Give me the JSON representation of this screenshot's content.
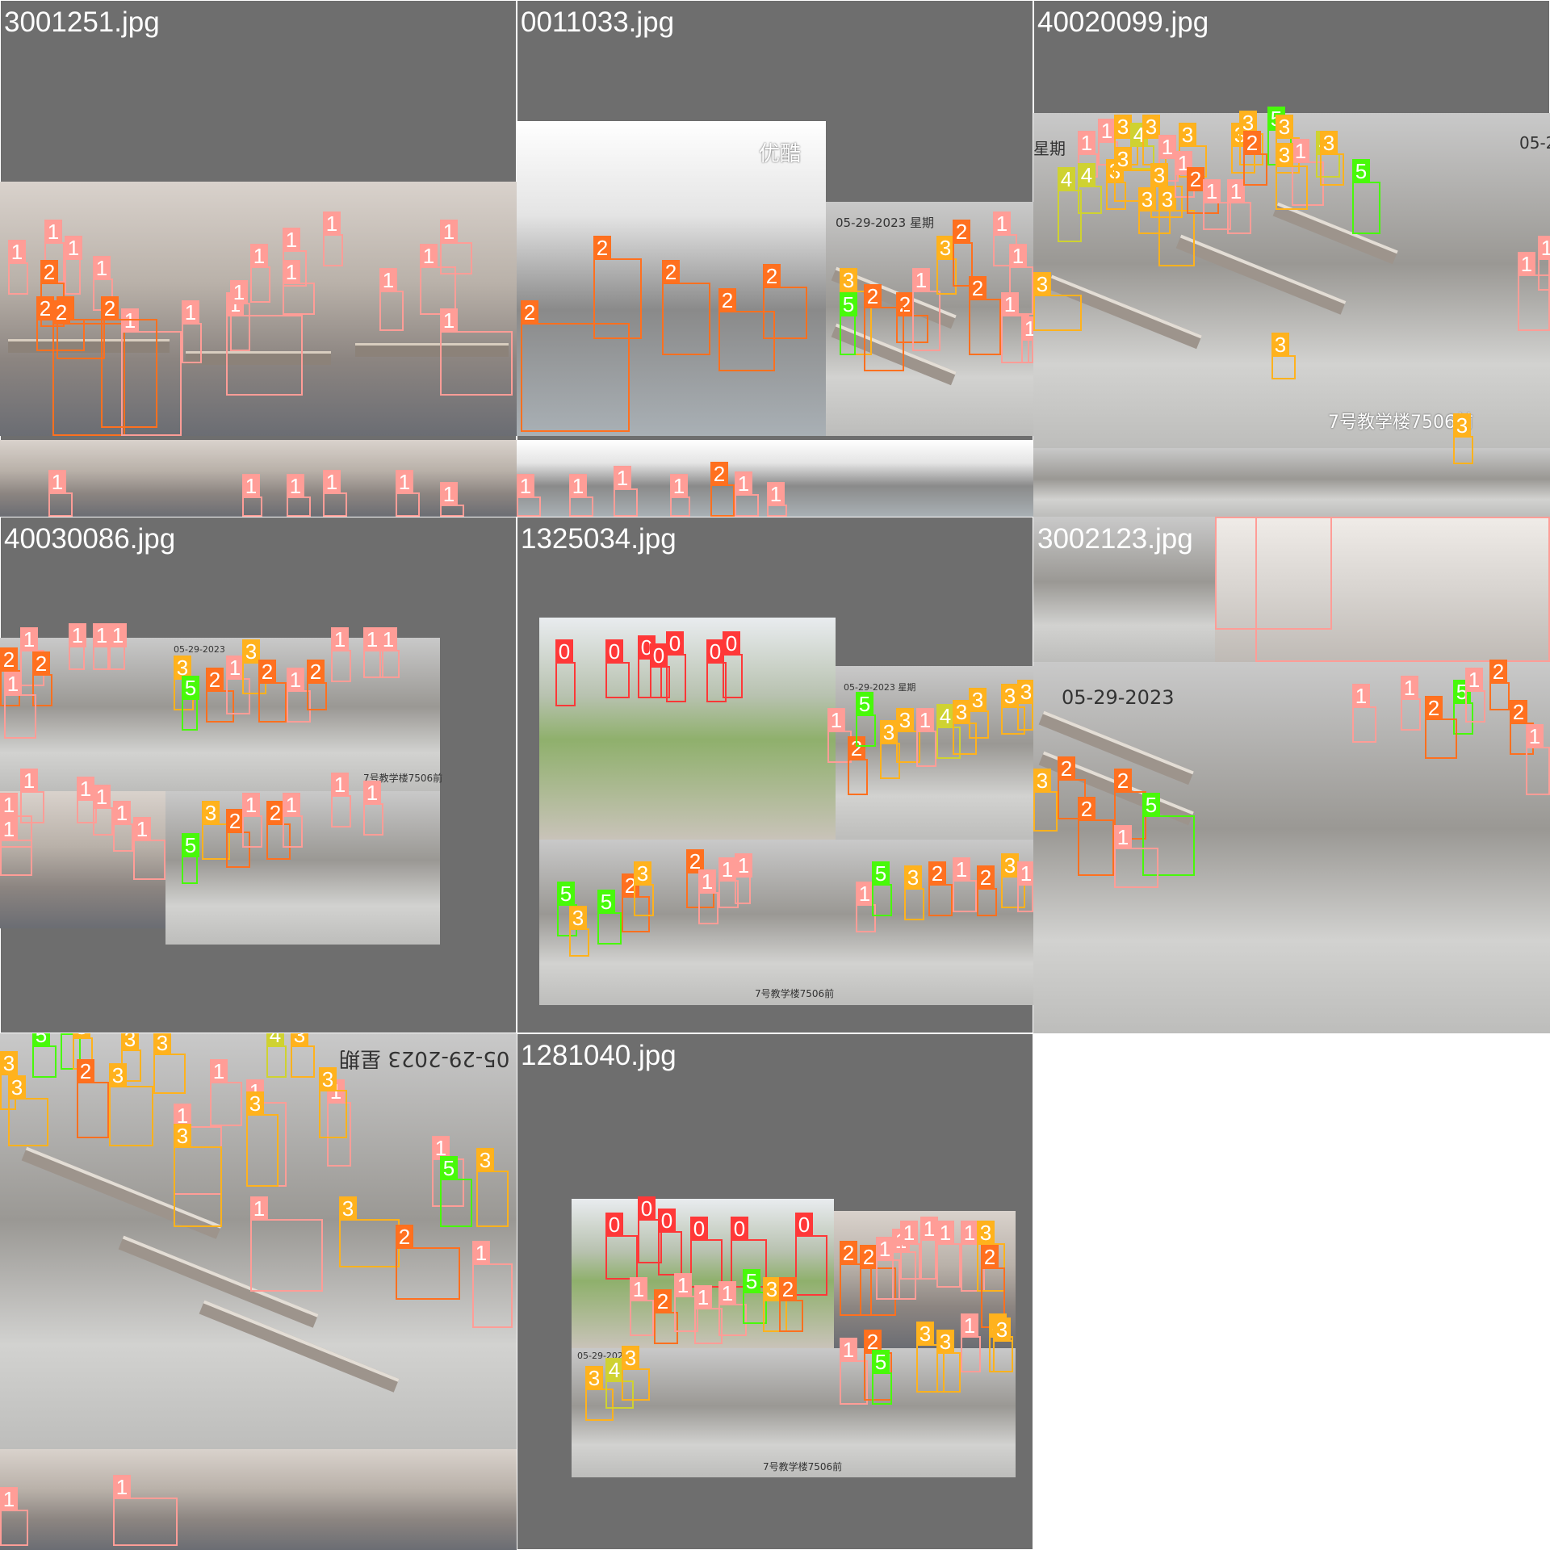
{
  "class_colors": {
    "0": "#ff3838",
    "1": "#ff9d97",
    "2": "#ff701f",
    "3": "#ffb21d",
    "4": "#cfd231",
    "5": "#48f90a"
  },
  "tiles": [
    {
      "label": "3001251.jpg",
      "boxes": [
        {
          "cls": "1"
        },
        {
          "cls": "1"
        },
        {
          "cls": "1"
        },
        {
          "cls": "2"
        },
        {
          "cls": "1"
        },
        {
          "cls": "2"
        },
        {
          "cls": "2"
        },
        {
          "cls": "2"
        },
        {
          "cls": "1"
        },
        {
          "cls": "2"
        },
        {
          "cls": "1"
        },
        {
          "cls": "1"
        },
        {
          "cls": "1"
        },
        {
          "cls": "1"
        },
        {
          "cls": "1"
        },
        {
          "cls": "1"
        },
        {
          "cls": "1"
        },
        {
          "cls": "1"
        },
        {
          "cls": "1"
        },
        {
          "cls": "1"
        },
        {
          "cls": "1"
        },
        {
          "cls": "1"
        },
        {
          "cls": "1"
        },
        {
          "cls": "1"
        },
        {
          "cls": "1"
        },
        {
          "cls": "1"
        },
        {
          "cls": "1"
        }
      ]
    },
    {
      "label": "0011033.jpg",
      "overlays": [
        "优酷",
        "05-29-2023 星期"
      ],
      "boxes": [
        {
          "cls": "2"
        },
        {
          "cls": "2"
        },
        {
          "cls": "2"
        },
        {
          "cls": "2"
        },
        {
          "cls": "2"
        },
        {
          "cls": "3"
        },
        {
          "cls": "2"
        },
        {
          "cls": "1"
        },
        {
          "cls": "5"
        },
        {
          "cls": "2"
        },
        {
          "cls": "3"
        },
        {
          "cls": "2"
        },
        {
          "cls": "1"
        },
        {
          "cls": "2"
        },
        {
          "cls": "1"
        },
        {
          "cls": "1"
        },
        {
          "cls": "1"
        },
        {
          "cls": "1"
        },
        {
          "cls": "1"
        },
        {
          "cls": "1"
        },
        {
          "cls": "1"
        },
        {
          "cls": "2"
        },
        {
          "cls": "1"
        },
        {
          "cls": "1"
        },
        {
          "cls": "1"
        }
      ]
    },
    {
      "label": "40020099.jpg",
      "overlays": [
        "7号教学楼7506前",
        "05-2",
        "星期"
      ],
      "boxes": [
        {
          "cls": "1"
        },
        {
          "cls": "1"
        },
        {
          "cls": "3"
        },
        {
          "cls": "4"
        },
        {
          "cls": "3"
        },
        {
          "cls": "1"
        },
        {
          "cls": "3"
        },
        {
          "cls": "3"
        },
        {
          "cls": "3"
        },
        {
          "cls": "5"
        },
        {
          "cls": "3"
        },
        {
          "cls": "1"
        },
        {
          "cls": "4"
        },
        {
          "cls": "4"
        },
        {
          "cls": "4"
        },
        {
          "cls": "3"
        },
        {
          "cls": "3"
        },
        {
          "cls": "3"
        },
        {
          "cls": "3"
        },
        {
          "cls": "1"
        },
        {
          "cls": "2"
        },
        {
          "cls": "1"
        },
        {
          "cls": "1"
        },
        {
          "cls": "3"
        },
        {
          "cls": "2"
        },
        {
          "cls": "3"
        },
        {
          "cls": "3"
        },
        {
          "cls": "5"
        },
        {
          "cls": "3"
        },
        {
          "cls": "3"
        },
        {
          "cls": "1"
        },
        {
          "cls": "1"
        },
        {
          "cls": "3"
        }
      ]
    },
    {
      "label": "40030086.jpg",
      "overlays": [
        "7号教学楼7506前",
        "05-29-2023"
      ],
      "boxes": [
        {
          "cls": "2"
        },
        {
          "cls": "1"
        },
        {
          "cls": "2"
        },
        {
          "cls": "1"
        },
        {
          "cls": "1"
        },
        {
          "cls": "1"
        },
        {
          "cls": "1"
        },
        {
          "cls": "3"
        },
        {
          "cls": "5"
        },
        {
          "cls": "2"
        },
        {
          "cls": "1"
        },
        {
          "cls": "3"
        },
        {
          "cls": "2"
        },
        {
          "cls": "1"
        },
        {
          "cls": "2"
        },
        {
          "cls": "1"
        },
        {
          "cls": "1"
        },
        {
          "cls": "1"
        },
        {
          "cls": "1"
        },
        {
          "cls": "1"
        },
        {
          "cls": "1"
        },
        {
          "cls": "1"
        },
        {
          "cls": "1"
        },
        {
          "cls": "1"
        },
        {
          "cls": "1"
        },
        {
          "cls": "5"
        },
        {
          "cls": "3"
        },
        {
          "cls": "2"
        },
        {
          "cls": "1"
        },
        {
          "cls": "2"
        },
        {
          "cls": "1"
        },
        {
          "cls": "1"
        },
        {
          "cls": "1"
        }
      ]
    },
    {
      "label": "1325034.jpg",
      "overlays": [
        "7号教学楼7506前",
        "05-29-2023 星期"
      ],
      "boxes": [
        {
          "cls": "0"
        },
        {
          "cls": "0"
        },
        {
          "cls": "0"
        },
        {
          "cls": "0"
        },
        {
          "cls": "0"
        },
        {
          "cls": "0"
        },
        {
          "cls": "0"
        },
        {
          "cls": "1"
        },
        {
          "cls": "2"
        },
        {
          "cls": "5"
        },
        {
          "cls": "3"
        },
        {
          "cls": "3"
        },
        {
          "cls": "1"
        },
        {
          "cls": "4"
        },
        {
          "cls": "3"
        },
        {
          "cls": "3"
        },
        {
          "cls": "3"
        },
        {
          "cls": "3"
        },
        {
          "cls": "5"
        },
        {
          "cls": "3"
        },
        {
          "cls": "5"
        },
        {
          "cls": "2"
        },
        {
          "cls": "3"
        },
        {
          "cls": "2"
        },
        {
          "cls": "1"
        },
        {
          "cls": "1"
        },
        {
          "cls": "1"
        },
        {
          "cls": "1"
        },
        {
          "cls": "5"
        },
        {
          "cls": "3"
        },
        {
          "cls": "2"
        },
        {
          "cls": "1"
        },
        {
          "cls": "2"
        },
        {
          "cls": "3"
        },
        {
          "cls": "1"
        }
      ]
    },
    {
      "label": "3002123.jpg",
      "overlays": [
        "05-29-2023"
      ],
      "boxes": [
        {
          "cls": "1"
        },
        {
          "cls": "1"
        },
        {
          "cls": "1"
        },
        {
          "cls": "1"
        },
        {
          "cls": "5"
        },
        {
          "cls": "1"
        },
        {
          "cls": "2"
        },
        {
          "cls": "2"
        },
        {
          "cls": "2"
        },
        {
          "cls": "1"
        },
        {
          "cls": "3"
        },
        {
          "cls": "2"
        },
        {
          "cls": "2"
        },
        {
          "cls": "5"
        },
        {
          "cls": "2"
        },
        {
          "cls": "1"
        }
      ]
    },
    {
      "label": "",
      "overlays": [
        "05-29-2023 星期"
      ],
      "boxes": [
        {
          "cls": "3"
        },
        {
          "cls": "5"
        },
        {
          "cls": "5"
        },
        {
          "cls": "3"
        },
        {
          "cls": "3"
        },
        {
          "cls": "3"
        },
        {
          "cls": "3"
        },
        {
          "cls": "2"
        },
        {
          "cls": "3"
        },
        {
          "cls": "1"
        },
        {
          "cls": "1"
        },
        {
          "cls": "4"
        },
        {
          "cls": "3"
        },
        {
          "cls": "1"
        },
        {
          "cls": "3"
        },
        {
          "cls": "1"
        },
        {
          "cls": "3"
        },
        {
          "cls": "1"
        },
        {
          "cls": "3"
        },
        {
          "cls": "1"
        },
        {
          "cls": "5"
        },
        {
          "cls": "3"
        },
        {
          "cls": "3"
        },
        {
          "cls": "2"
        },
        {
          "cls": "1"
        },
        {
          "cls": "1"
        },
        {
          "cls": "1"
        }
      ]
    },
    {
      "label": "1281040.jpg",
      "overlays": [
        "7号教学楼7506前",
        "05-29-2023"
      ],
      "boxes": [
        {
          "cls": "0"
        },
        {
          "cls": "0"
        },
        {
          "cls": "0"
        },
        {
          "cls": "0"
        },
        {
          "cls": "0"
        },
        {
          "cls": "0"
        },
        {
          "cls": "2"
        },
        {
          "cls": "2"
        },
        {
          "cls": "1"
        },
        {
          "cls": "1"
        },
        {
          "cls": "1"
        },
        {
          "cls": "1"
        },
        {
          "cls": "1"
        },
        {
          "cls": "1"
        },
        {
          "cls": "3"
        },
        {
          "cls": "2"
        },
        {
          "cls": "1"
        },
        {
          "cls": "2"
        },
        {
          "cls": "1"
        },
        {
          "cls": "1"
        },
        {
          "cls": "1"
        },
        {
          "cls": "5"
        },
        {
          "cls": "3"
        },
        {
          "cls": "2"
        },
        {
          "cls": "1"
        },
        {
          "cls": "2"
        },
        {
          "cls": "5"
        },
        {
          "cls": "3"
        },
        {
          "cls": "3"
        },
        {
          "cls": "1"
        },
        {
          "cls": "3"
        },
        {
          "cls": "3"
        },
        {
          "cls": "3"
        },
        {
          "cls": "4"
        },
        {
          "cls": "3"
        }
      ]
    }
  ]
}
